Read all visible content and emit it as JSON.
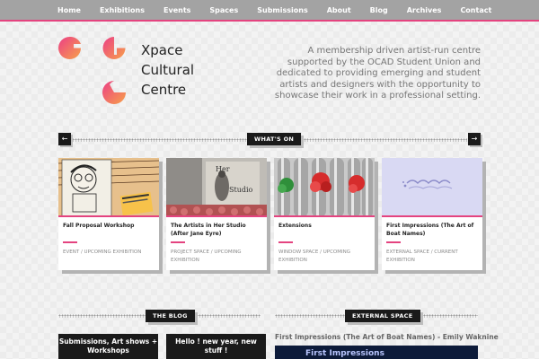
{
  "nav": {
    "items": [
      "Home",
      "Exhibitions",
      "Events",
      "Spaces",
      "Submissions",
      "About",
      "Blog",
      "Archives",
      "Contact"
    ]
  },
  "logo": {
    "line1": "Xpace",
    "line2": "Cultural",
    "line3": "Centre"
  },
  "tagline": "A membership driven artist-run centre supported by the OCAD Student Union and dedicated to providing emerging and student artists and designers with the opportunity to showcase their work in a professional setting.",
  "whats_on": {
    "label": "WHAT'S ON",
    "prev": "←",
    "next": "→",
    "cards": [
      {
        "title": "Fall Proposal Workshop",
        "cat1": "EVENT",
        "sep": "/",
        "cat2": "UPCOMING EXHIBITION"
      },
      {
        "title": "The Artists in Her Studio (After Jane Eyre)",
        "cat1": "PROJECT SPACE",
        "sep": "/",
        "cat2": "UPCOMING EXHIBITION"
      },
      {
        "title": "Extensions",
        "cat1": "WINDOW SPACE",
        "sep": "/",
        "cat2": "UPCOMING EXHIBITION"
      },
      {
        "title": "First Impressions (The Art of Boat Names)",
        "cat1": "EXTERNAL SPACE",
        "sep": "/",
        "cat2": "CURRENT EXHIBITION"
      }
    ]
  },
  "blog": {
    "label": "THE BLOG",
    "posts": [
      {
        "line1": "Submissions, Art shows +",
        "line2": "Workshops"
      },
      {
        "line1": "Hello ! new year, new",
        "line2": "stuff !"
      }
    ]
  },
  "external": {
    "label": "EXTERNAL SPACE",
    "title": "First Impressions (The Art of Boat Names) - Emily Waknine",
    "image_text": "First Impressions"
  },
  "colors": {
    "accent": "#e4437f",
    "nav_bg": "#a3a3a3",
    "dark": "#1a1a1a"
  }
}
